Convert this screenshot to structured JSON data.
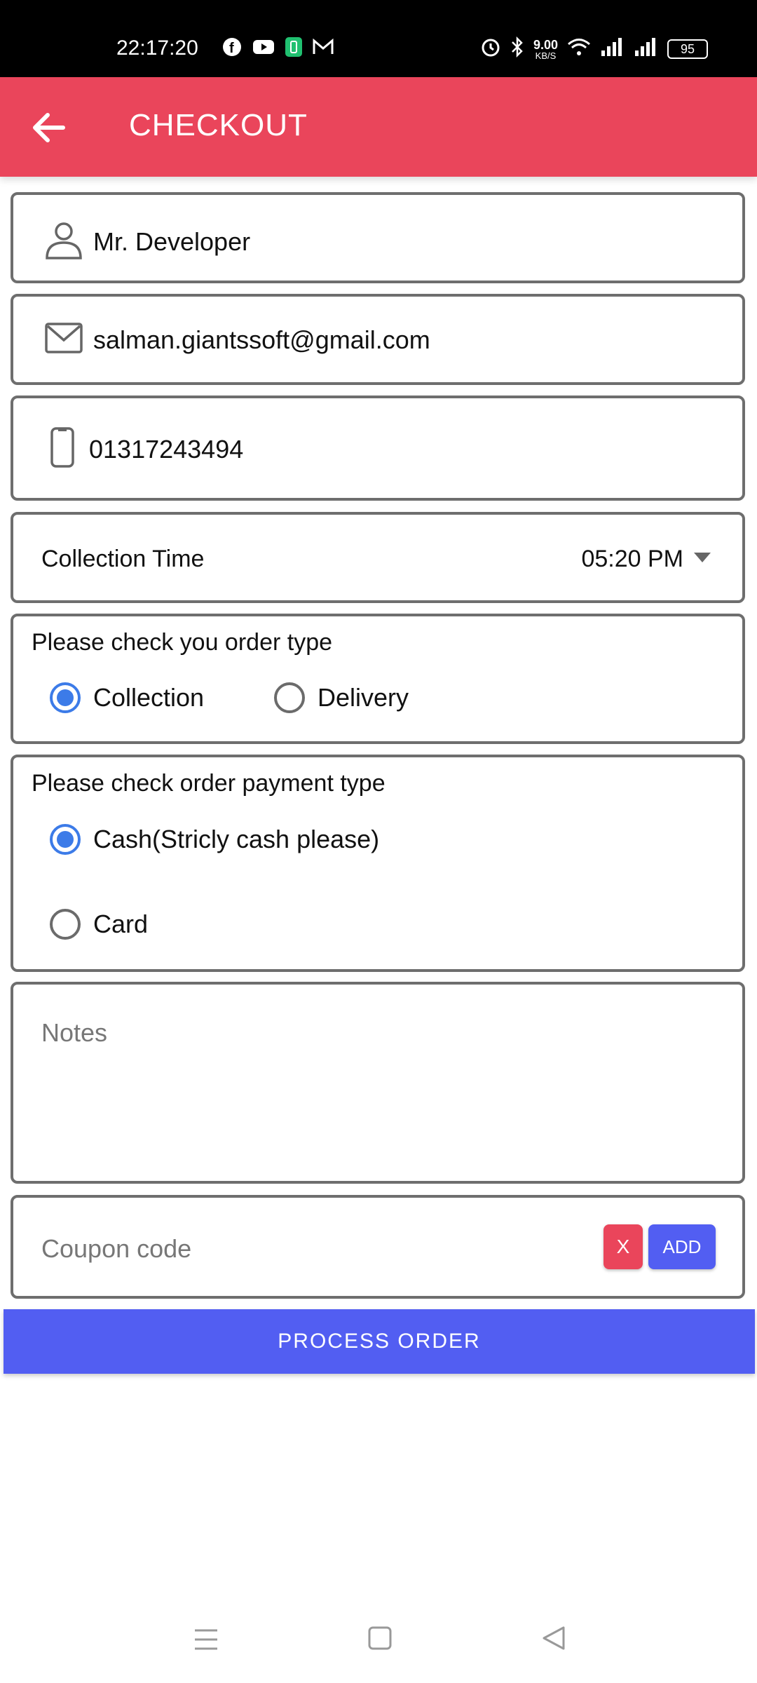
{
  "status_bar": {
    "time": "22:17:20",
    "net_speed_value": "9.00",
    "net_speed_unit": "KB/S",
    "battery": "95",
    "app_icons": [
      "facebook-icon",
      "youtube-icon",
      "battery-saver-icon",
      "gmail-icon"
    ]
  },
  "app_bar": {
    "title": "CHECKOUT"
  },
  "form": {
    "name": "Mr. Developer",
    "email": "salman.giantssoft@gmail.com",
    "phone": "01317243494",
    "collection_time_label": "Collection Time",
    "collection_time_value": "05:20 PM",
    "order_type": {
      "heading": "Please check you order type",
      "options": [
        "Collection",
        "Delivery"
      ],
      "selected": "Collection"
    },
    "payment_type": {
      "heading": "Please check order payment type",
      "options": [
        "Cash(Stricly cash please)",
        "Card"
      ],
      "selected": "Cash(Stricly cash please)"
    },
    "notes_placeholder": "Notes",
    "coupon_placeholder": "Coupon code",
    "coupon_clear_label": "X",
    "coupon_add_label": "ADD",
    "process_label": "PROCESS ORDER"
  },
  "colors": {
    "accent_red": "#ea455b",
    "accent_blue": "#525ef2",
    "radio_blue": "#3c7be8"
  }
}
